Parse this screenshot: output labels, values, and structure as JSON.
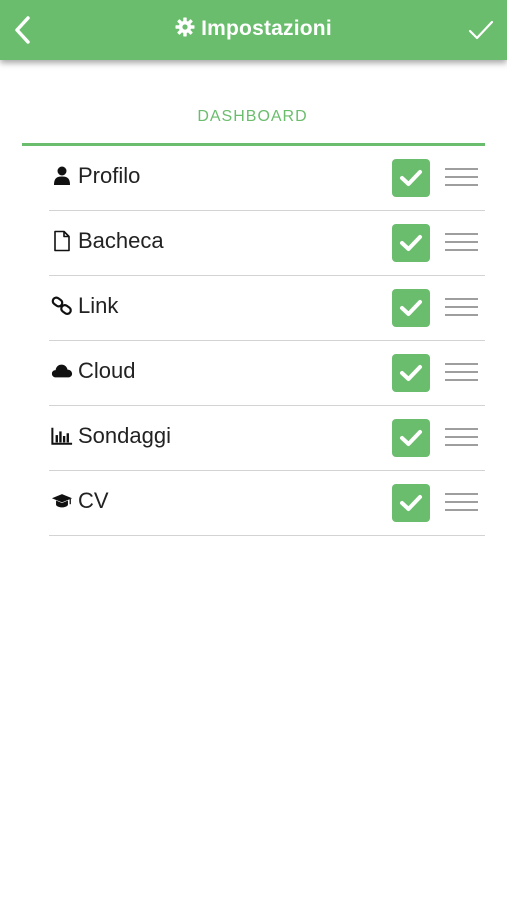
{
  "appbar": {
    "title": "Impostazioni",
    "title_icon": "gear-icon",
    "back_icon": "chevron-left-icon",
    "confirm_icon": "checkmark-icon",
    "color": "#6bbd6e"
  },
  "tab": {
    "label": "DASHBOARD"
  },
  "items": [
    {
      "label": "Profilo",
      "icon": "user-icon",
      "checked": true
    },
    {
      "label": "Bacheca",
      "icon": "file-icon",
      "checked": true
    },
    {
      "label": "Link",
      "icon": "link-icon",
      "checked": true
    },
    {
      "label": "Cloud",
      "icon": "cloud-icon",
      "checked": true
    },
    {
      "label": "Sondaggi",
      "icon": "bar-chart-icon",
      "checked": true
    },
    {
      "label": "CV",
      "icon": "graduation-cap-icon",
      "checked": true
    }
  ]
}
